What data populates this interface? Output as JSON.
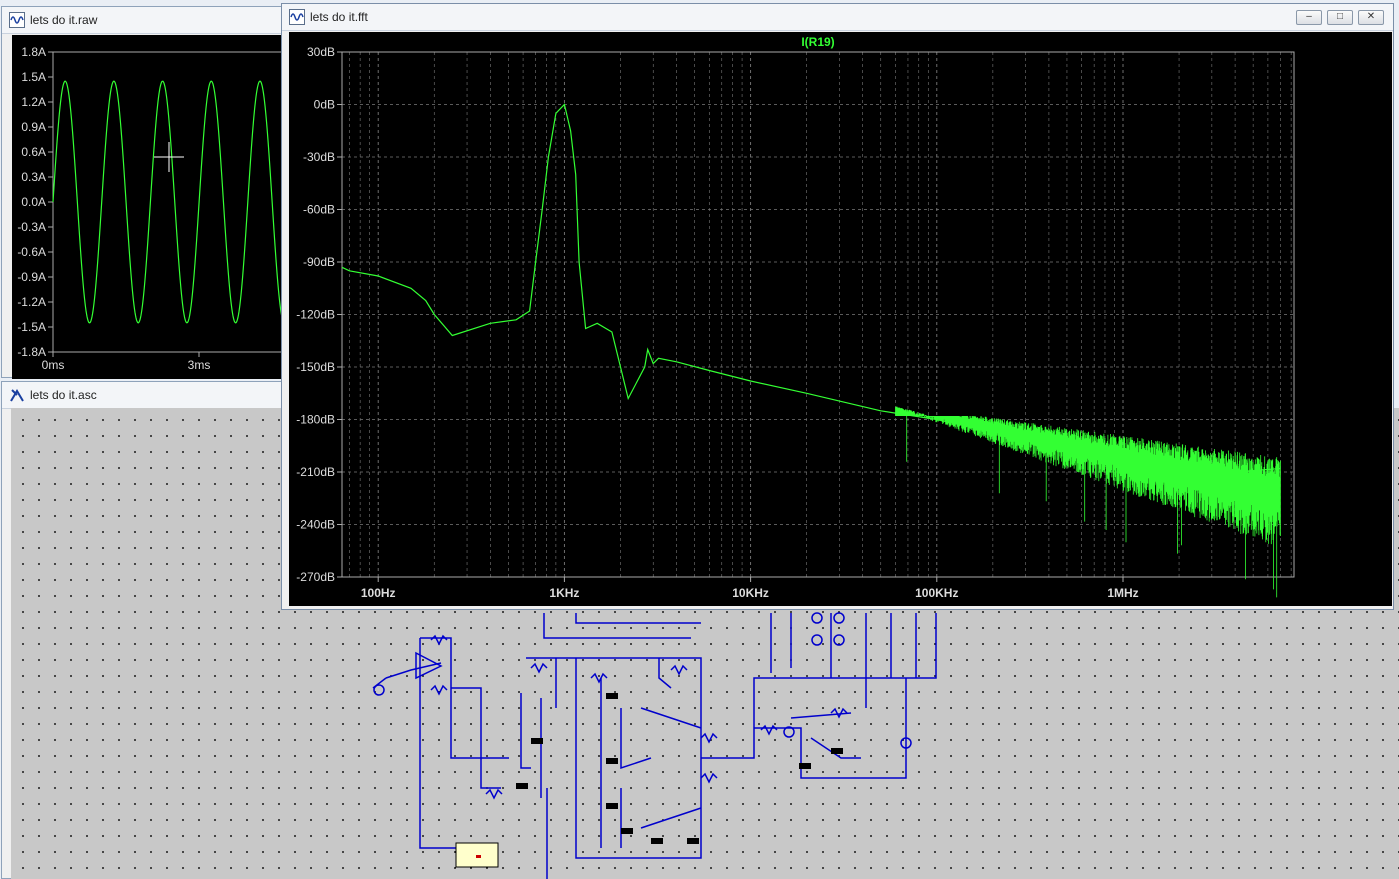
{
  "raw_window": {
    "title": "lets do it.raw",
    "y_ticks": [
      "1.8A",
      "1.5A",
      "1.2A",
      "0.9A",
      "0.6A",
      "0.3A",
      "0.0A",
      "-0.3A",
      "-0.6A",
      "-0.9A",
      "-1.2A",
      "-1.5A",
      "-1.8A"
    ],
    "x_ticks": [
      "0ms",
      "3ms"
    ]
  },
  "asc_window": {
    "title": "lets do it.asc"
  },
  "fft_window": {
    "title": "lets do it.fft",
    "controls": {
      "minimize": "–",
      "maximize": "□",
      "close": "✕"
    }
  },
  "chart_data": [
    {
      "type": "line",
      "title": "",
      "xlabel": "",
      "ylabel": "",
      "x_ticks": [
        "0ms",
        "3ms"
      ],
      "y_ticks": [
        "1.8A",
        "1.5A",
        "1.2A",
        "0.9A",
        "0.6A",
        "0.3A",
        "0.0A",
        "-0.3A",
        "-0.6A",
        "-0.9A",
        "-1.2A",
        "-1.5A",
        "-1.8A"
      ],
      "ylim": [
        -1.8,
        1.8
      ],
      "series": [
        {
          "amplitude": 1.45,
          "frequency_hz": 1000,
          "color": "#33ff33"
        }
      ]
    },
    {
      "type": "line",
      "title": "I(R19)",
      "xlabel": "",
      "ylabel": "",
      "x_scale": "log",
      "x_ticks": [
        "100Hz",
        "1KHz",
        "10KHz",
        "100KHz",
        "1MHz"
      ],
      "y_ticks": [
        "30dB",
        "0dB",
        "-30dB",
        "-60dB",
        "-90dB",
        "-120dB",
        "-150dB",
        "-180dB",
        "-210dB",
        "-240dB",
        "-270dB"
      ],
      "ylim": [
        -270,
        30
      ],
      "grid": true,
      "series": [
        {
          "name": "I(R19)",
          "color": "#33ff33",
          "x": [
            50,
            70,
            100,
            150,
            180,
            200,
            250,
            400,
            550,
            650,
            700,
            760,
            820,
            900,
            1000,
            1080,
            1150,
            1200,
            1300,
            1500,
            1800,
            2000,
            2200,
            2700,
            2800,
            3000,
            3200,
            4000,
            6000,
            10000,
            20000,
            50000,
            100000,
            200000,
            500000,
            1000000,
            2000000,
            4000000,
            7000000
          ],
          "y": [
            -93,
            -95,
            -98,
            -105,
            -112,
            -120,
            -132,
            -125,
            -123,
            -118,
            -90,
            -60,
            -30,
            -5,
            0,
            -15,
            -40,
            -90,
            -128,
            -125,
            -130,
            -150,
            -168,
            -150,
            -140,
            -148,
            -145,
            -147,
            -152,
            -158,
            -165,
            -175,
            -180,
            -187,
            -193,
            -198,
            -205,
            -210,
            -208
          ]
        }
      ]
    }
  ]
}
